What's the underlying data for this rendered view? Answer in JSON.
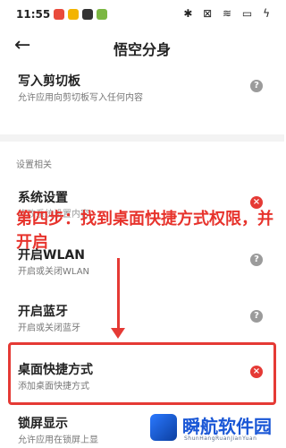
{
  "status_bar": {
    "time": "11:55",
    "right": "✱ ⊠ ≋ ▭ ϟ"
  },
  "header": {
    "back": "←",
    "title": "悟空分身"
  },
  "rows": [
    {
      "title": "写入剪切板",
      "subtitle": "允许应用向剪切板写入任何内容",
      "icon": "gray"
    },
    {
      "title": "系统设置",
      "subtitle": "修改系统设置内容",
      "icon": "red"
    },
    {
      "title": "开启WLAN",
      "subtitle": "开启或关闭WLAN",
      "icon": "gray"
    },
    {
      "title": "开启蓝牙",
      "subtitle": "开启或关闭蓝牙",
      "icon": "gray"
    },
    {
      "title": "桌面快捷方式",
      "subtitle": "添加桌面快捷方式",
      "icon": "red"
    },
    {
      "title": "锁屏显示",
      "subtitle": "允许应用在锁屏上显",
      "icon": "none"
    }
  ],
  "section_label": "设置相关",
  "annotation": "第四步：找到桌面快捷方式权限，并开启",
  "icons": {
    "gray": "?",
    "red": "×"
  },
  "watermark": {
    "text": "瞬航软件园",
    "sub": "ShunHangRuanJianYuan"
  },
  "colors": {
    "accent_red": "#e53a35",
    "watermark_blue": "#1a57d6"
  }
}
